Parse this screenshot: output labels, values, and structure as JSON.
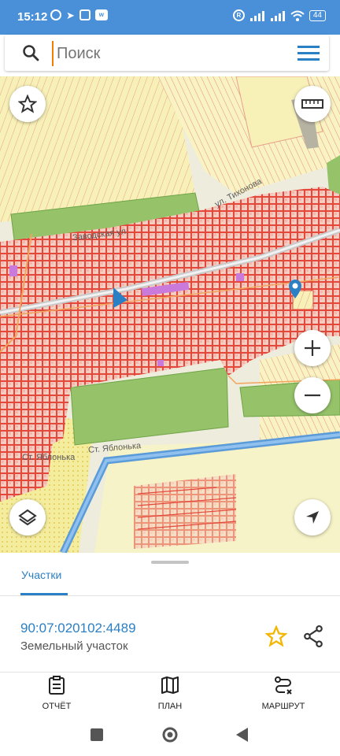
{
  "status_bar": {
    "time": "15:12",
    "right_indicator": "R",
    "battery": "44"
  },
  "search": {
    "placeholder": "Поиск"
  },
  "map": {
    "street_labels": [
      "Заводская ул.",
      "ул. Тихонова",
      "Ст. Яблонька",
      "Ст. Яблонька"
    ]
  },
  "sheet": {
    "tab_label": "Участки",
    "cadastral_number": "90:07:020102:4489",
    "land_type": "Земельный участок",
    "bottom_nav": [
      {
        "label": "ОТЧЁТ",
        "icon": "report-icon"
      },
      {
        "label": "ПЛАН",
        "icon": "map-plan-icon"
      },
      {
        "label": "МАРШРУТ",
        "icon": "route-icon"
      }
    ]
  },
  "colors": {
    "accent": "#2b7fc4",
    "status_bar": "#4a90d9",
    "parcel_border": "#e25b4a",
    "field_green": "#96c36a",
    "canal": "#5b9bd9",
    "star": "#f2b705"
  }
}
